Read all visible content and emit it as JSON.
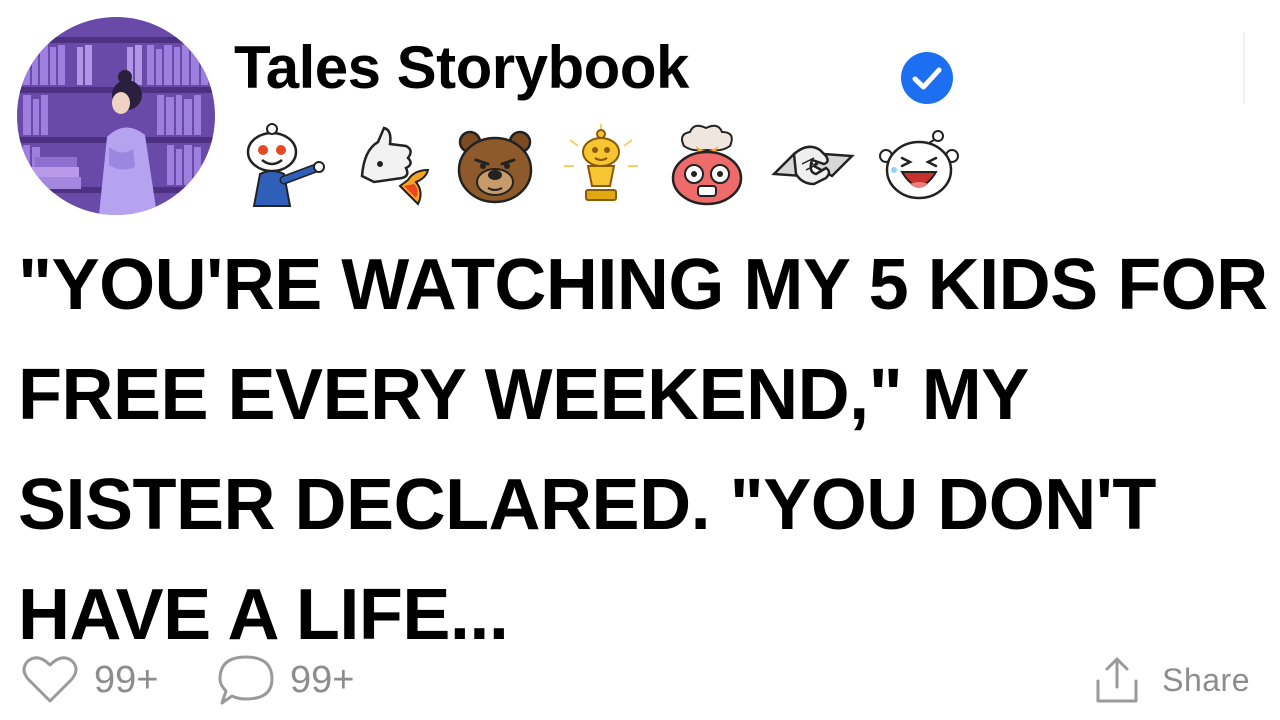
{
  "account": {
    "name": "Tales Storybook",
    "verified": true
  },
  "awards": [
    {
      "icon": "pointing-snoo-icon"
    },
    {
      "icon": "rocket-thumbs-up-icon"
    },
    {
      "icon": "bear-face-icon"
    },
    {
      "icon": "gold-trophy-snoo-icon"
    },
    {
      "icon": "mind-blown-icon"
    },
    {
      "icon": "handshake-icon"
    },
    {
      "icon": "laughing-snoo-icon"
    }
  ],
  "post": {
    "headline": "\"YOU'RE WATCHING MY 5 KIDS FOR FREE EVERY WEEKEND,\" MY SISTER DECLARED. \"YOU DON'T HAVE A LIFE..."
  },
  "footer": {
    "likes": "99+",
    "comments": "99+",
    "share_label": "Share"
  },
  "colors": {
    "verified_blue": "#1d6ff2",
    "muted_gray": "#8d8d8d",
    "avatar_purple": "#7b5bbf"
  }
}
